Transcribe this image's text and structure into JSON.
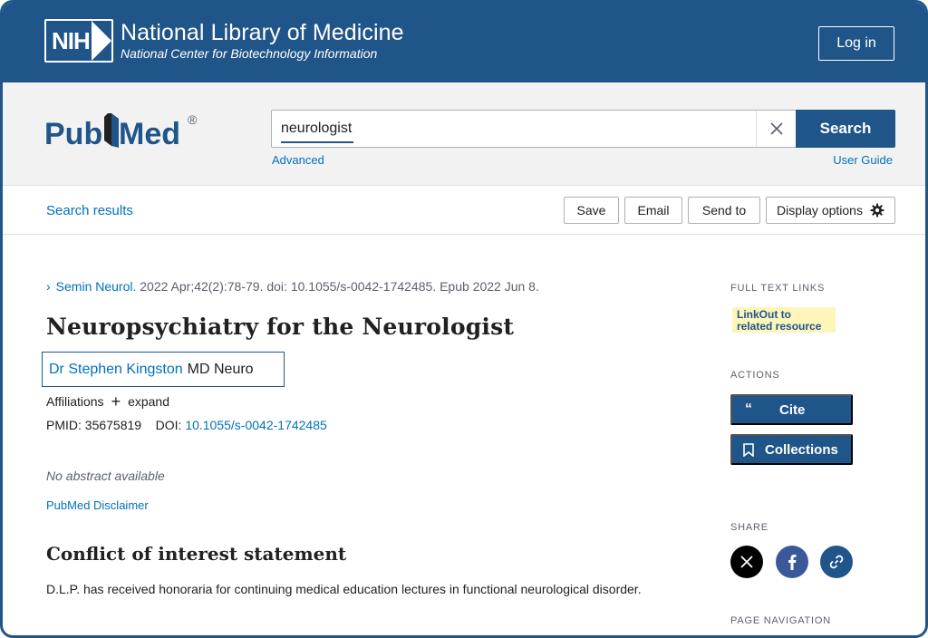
{
  "nih": {
    "logo_text": "NIH",
    "title": "National Library of Medicine",
    "subtitle": "National Center for Biotechnology Information",
    "login_label": "Log in"
  },
  "search": {
    "logo_text": "PubMed",
    "logo_mark": "®",
    "query": "neurologist",
    "button_label": "Search",
    "advanced_label": "Advanced",
    "user_guide_label": "User Guide"
  },
  "toolbar": {
    "search_results_label": "Search results",
    "save_label": "Save",
    "email_label": "Email",
    "send_to_label": "Send to",
    "display_options_label": "Display options"
  },
  "article": {
    "journal": "Semin Neurol.",
    "citation_rest": " 2022 Apr;42(2):78-79. doi: 10.1055/s-0042-1742485. Epub 2022 Jun 8.",
    "title": "Neuropsychiatry for the Neurologist",
    "author_name": "Dr Stephen Kingston",
    "author_degree": "MD Neuro",
    "affiliations_label": "Affiliations",
    "expand_label": "expand",
    "pmid_label": "PMID: 35675819",
    "doi_label": "DOI: ",
    "doi_value": "10.1055/s-0042-1742485",
    "no_abstract": "No abstract available",
    "disclaimer": "PubMed Disclaimer",
    "coi_heading": "Conflict of interest statement",
    "coi_text": "D.L.P. has received honoraria for continuing medical education lectures in functional neurological disorder."
  },
  "sidebar": {
    "full_text_heading": "FULL TEXT LINKS",
    "linkout_line1": "LinkOut to",
    "linkout_line2": "related resource",
    "actions_heading": "ACTIONS",
    "cite_label": "Cite",
    "collections_label": "Collections",
    "share_heading": "SHARE",
    "page_nav_heading": "PAGE NAVIGATION"
  },
  "colors": {
    "brand_blue": "#20558a",
    "link_blue": "#0071bc",
    "linkout_bg": "#fdf5b9",
    "facebook_blue": "#3b5998"
  }
}
